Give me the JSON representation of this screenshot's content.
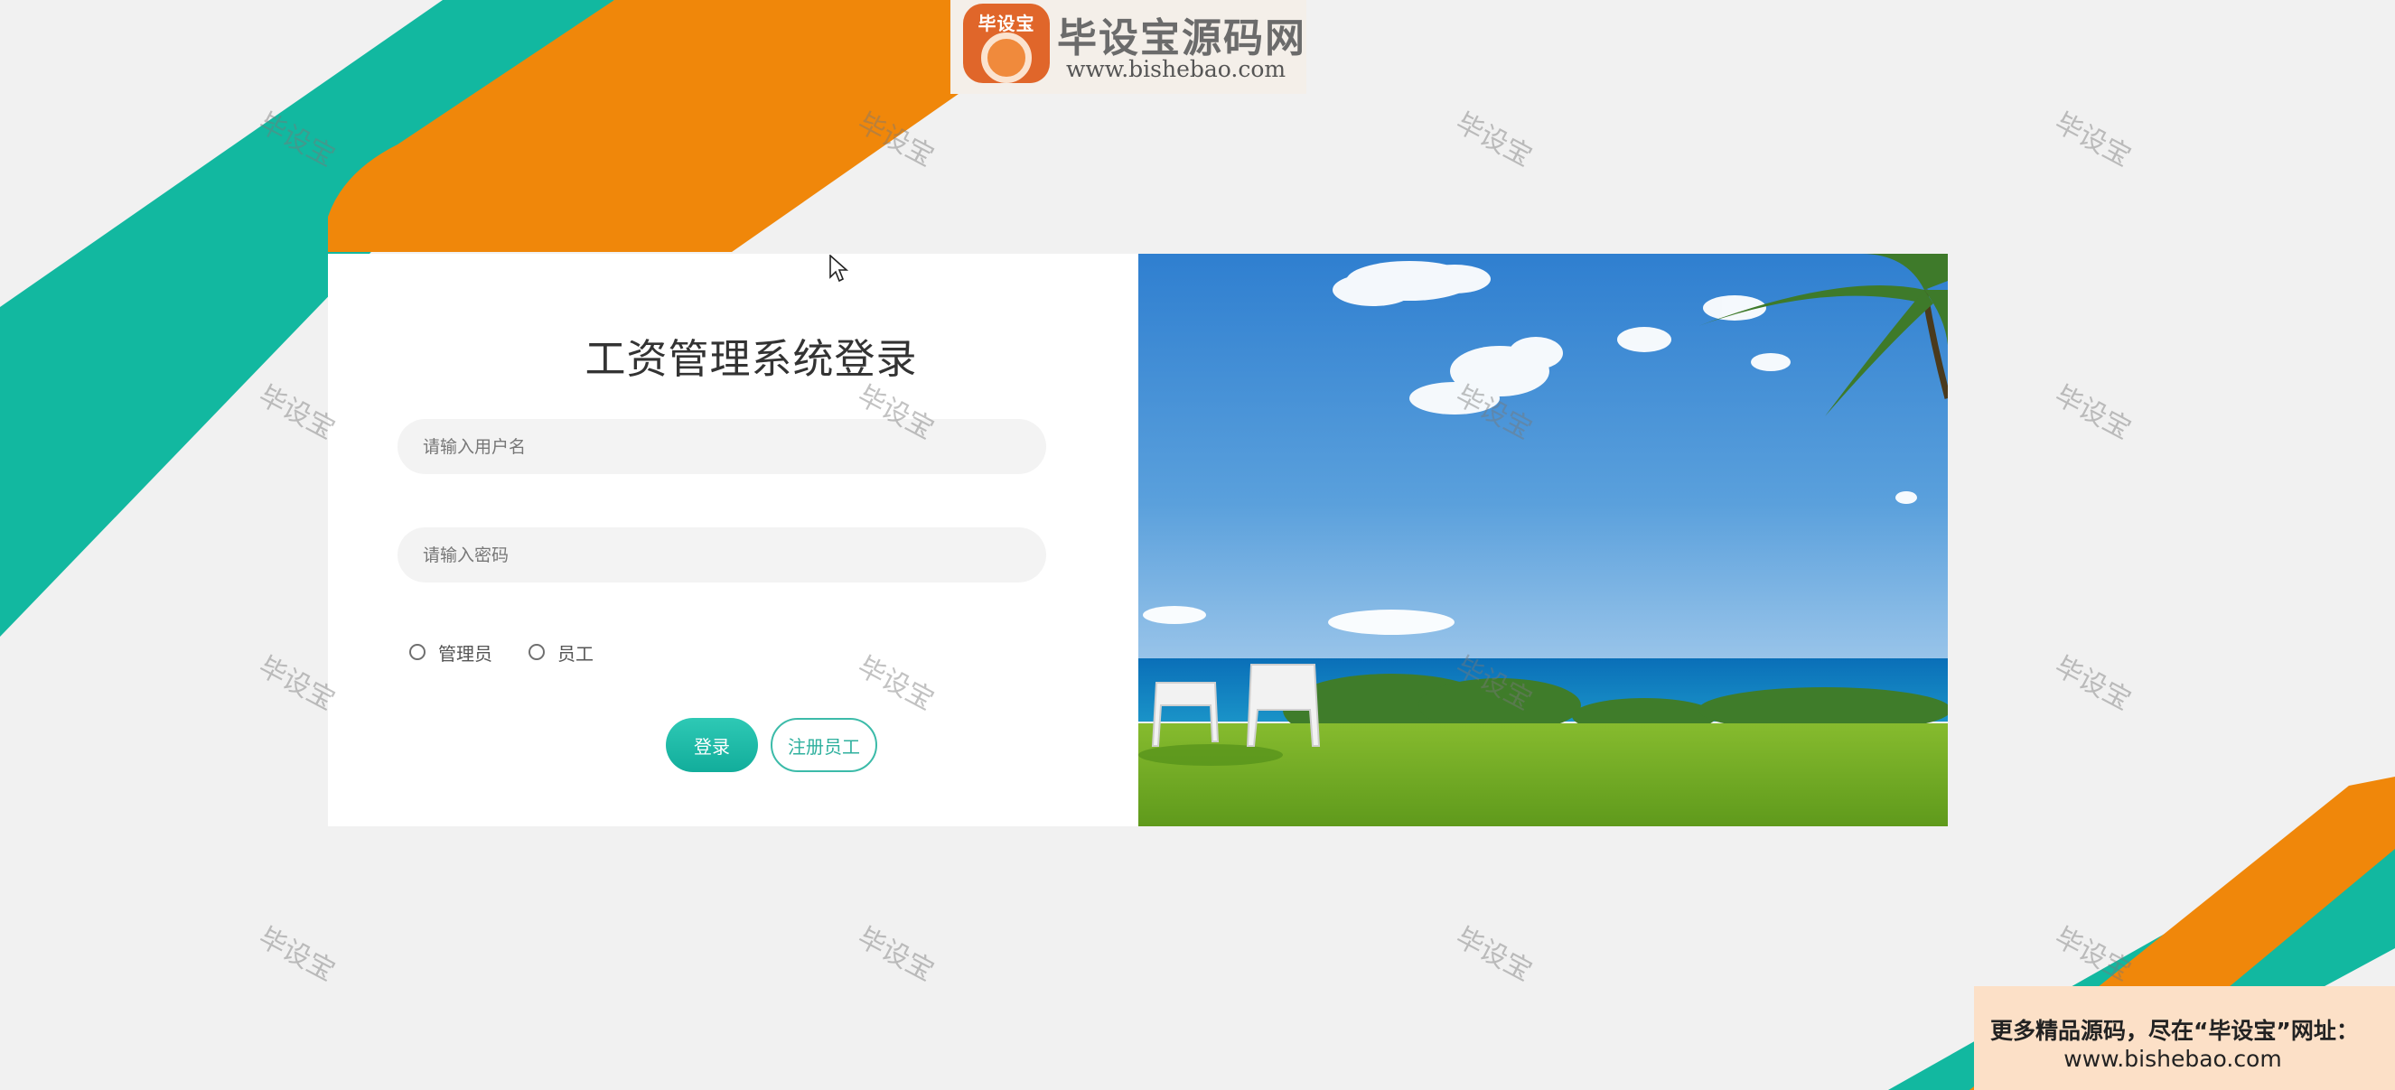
{
  "brand": {
    "badge_text": "毕设宝",
    "title": "毕设宝源码网",
    "url": "www.bishebao.com"
  },
  "login": {
    "title": "工资管理系统登录",
    "username_placeholder": "请输入用户名",
    "password_placeholder": "请输入密码",
    "roles": [
      {
        "label": "管理员",
        "selected": false
      },
      {
        "label": "员工",
        "selected": false
      }
    ],
    "login_button": "登录",
    "register_button": "注册员工"
  },
  "watermark_text": "毕设宝",
  "promo": {
    "line1": "更多精品源码，尽在“毕设宝”网址：",
    "line2": "www.bishebao.com"
  },
  "colors": {
    "teal": "#12b8a0",
    "orange": "#f0870a",
    "background": "#f1f1f1",
    "card": "#ffffff"
  }
}
